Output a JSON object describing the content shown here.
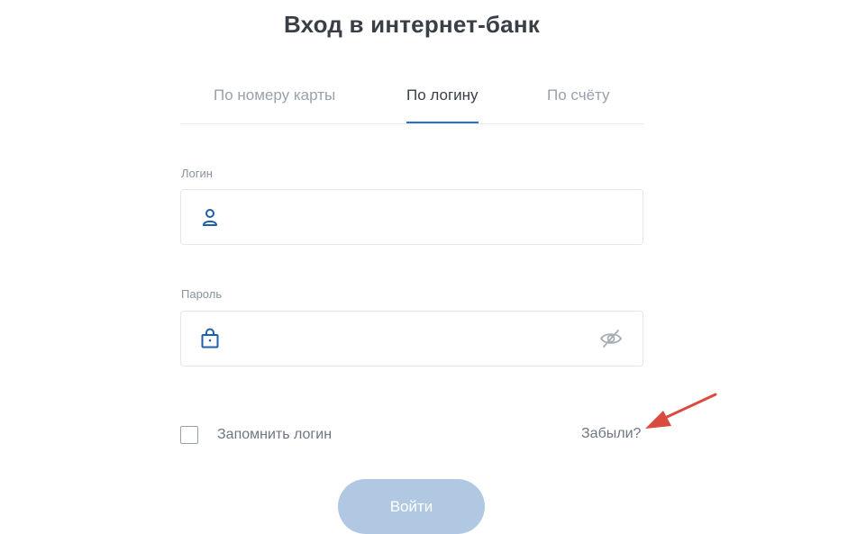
{
  "header": {
    "title": "Вход в интернет-банк"
  },
  "tabs": [
    {
      "label": "По номеру карты",
      "active": false
    },
    {
      "label": "По логину",
      "active": true
    },
    {
      "label": "По счёту",
      "active": false
    }
  ],
  "login": {
    "label": "Логин",
    "value": "",
    "icon": "user-icon"
  },
  "password": {
    "label": "Пароль",
    "value": "",
    "icon": "lock-icon",
    "toggle_icon": "eye-hidden-icon"
  },
  "remember": {
    "label": "Запомнить логин",
    "checked": false
  },
  "forgot": {
    "label": "Забыли?"
  },
  "submit": {
    "label": "Войти"
  },
  "colors": {
    "accent": "#2a6fc9",
    "button": "#b1c8e2",
    "annotation": "#d94b3e"
  }
}
